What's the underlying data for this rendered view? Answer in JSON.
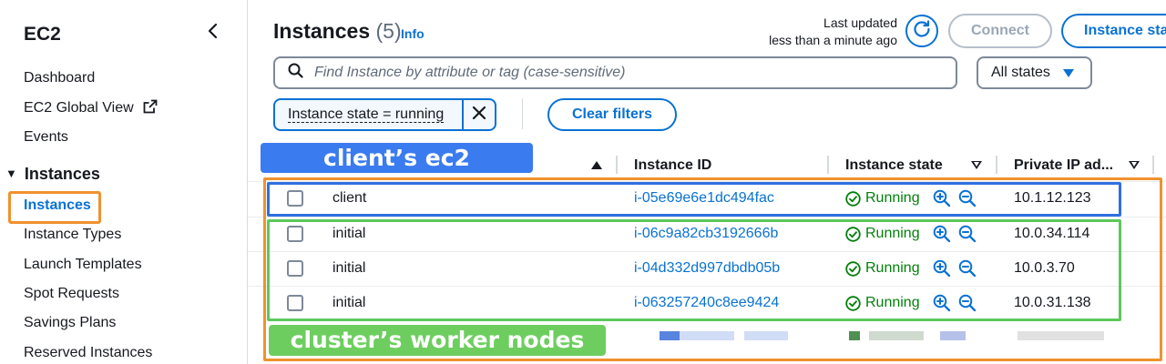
{
  "sidebar": {
    "title": "EC2",
    "items_top": [
      {
        "label": "Dashboard"
      },
      {
        "label": "EC2 Global View"
      },
      {
        "label": "Events"
      }
    ],
    "section": "Instances",
    "items": [
      {
        "label": "Instances",
        "active": true
      },
      {
        "label": "Instance Types"
      },
      {
        "label": "Launch Templates"
      },
      {
        "label": "Spot Requests"
      },
      {
        "label": "Savings Plans"
      },
      {
        "label": "Reserved Instances"
      }
    ]
  },
  "header": {
    "title": "Instances",
    "count": "(5)",
    "info": "Info",
    "last_updated_label": "Last updated",
    "last_updated_value": "less than a minute ago",
    "connect_label": "Connect",
    "instance_state_label": "Instance state"
  },
  "search": {
    "placeholder": "Find Instance by attribute or tag (case-sensitive)",
    "states_select": "All states"
  },
  "filters": {
    "token_label": "Instance state = running",
    "clear_label": "Clear filters"
  },
  "table": {
    "columns": [
      "Instance ID",
      "Instance state",
      "Private IP ad..."
    ],
    "rows": [
      {
        "name": "client",
        "id": "i-05e69e6e1dc494fac",
        "state": "Running",
        "ip": "10.1.12.123"
      },
      {
        "name": "initial",
        "id": "i-06c9a82cb3192666b",
        "state": "Running",
        "ip": "10.0.34.114"
      },
      {
        "name": "initial",
        "id": "i-04d332d997dbdb05b",
        "state": "Running",
        "ip": "10.0.3.70"
      },
      {
        "name": "initial",
        "id": "i-063257240c8ee9424",
        "state": "Running",
        "ip": "10.0.31.138"
      }
    ]
  },
  "annotations": {
    "client_label": "client’s ec2",
    "workers_label": "cluster’s worker nodes"
  },
  "colors": {
    "accent": "#0972d3",
    "running": "#037f0c",
    "annotation_orange": "#f0912e",
    "annotation_blue": "#2f6fe0",
    "annotation_green": "#5cc85c"
  }
}
